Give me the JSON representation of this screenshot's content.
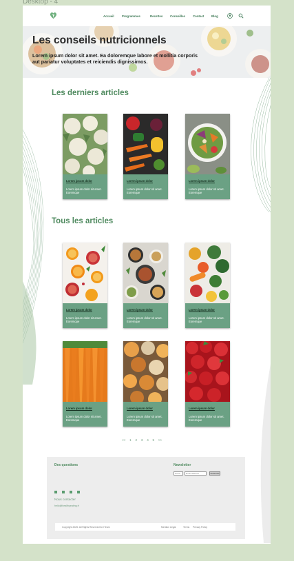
{
  "canvas_label": "Desktop - 4",
  "header": {
    "logo_icon": "heart-leaf-icon",
    "nav": [
      "Accueil",
      "Programmes",
      "Recettes",
      "Conseilles",
      "Contact",
      "Blog"
    ],
    "user_icon": "user-circle-icon",
    "search_icon": "search-icon"
  },
  "hero": {
    "title": "Les conseils nutricionnels",
    "subtitle": "Lorem ipsum dolor sit amet. Ea doloremque labore et mollitia corporis aut pariatur voluptates et reiciendis dignissimos."
  },
  "latest": {
    "title": "Les derniers articles",
    "cards": [
      {
        "title": "Lorem ipsum dolor",
        "text": "Lorem ipsum dolor sit amet. Eoremque"
      },
      {
        "title": "Lorem ipsum dolor",
        "text": "Lorem ipsum dolor sit amet. Eoremque"
      },
      {
        "title": "Lorem ipsum dolor",
        "text": "Lorem ipsum dolor sit amet. Eoremque"
      }
    ]
  },
  "all": {
    "title": "Tous les articles",
    "cards": [
      {
        "title": "Lorem ipsum dolor",
        "text": "Lorem ipsum dolor sit amet. Eoremque"
      },
      {
        "title": "Lorem ipsum dolor",
        "text": "Lorem ipsum dolor sit amet. Eoremque"
      },
      {
        "title": "Lorem ipsum dolor",
        "text": "Lorem ipsum dolor sit amet. Eoremque"
      },
      {
        "title": "Lorem ipsum dolor",
        "text": "Lorem ipsum dolor sit amet. Eoremque"
      },
      {
        "title": "Lorem ipsum dolor",
        "text": "Lorem ipsum dolor sit amet. Eoremque"
      },
      {
        "title": "Lorem ipsum dolor",
        "text": "Lorem ipsum dolor sit amet. Eoremque"
      }
    ]
  },
  "pagination": {
    "prev": "<<",
    "pages": [
      "1",
      "2",
      "3",
      "4",
      "5"
    ],
    "next": ">>"
  },
  "footer": {
    "questions": "Des questions",
    "newsletter": "Newsletter",
    "name_placeholder": "Name",
    "email_placeholder": "Email address",
    "subscribe": "Subscribe",
    "contact": "Nous contacter",
    "email": "hello@healthyeating.fr",
    "copyright": "Copyright 2025. All Rights Reserved for ITeam",
    "legal": "Mention Légal",
    "terms": "Terms",
    "privacy": "Privacy Policy"
  },
  "colors": {
    "accent": "#4f8a5f",
    "card": "#6ba184",
    "background": "#d4e2c9"
  }
}
